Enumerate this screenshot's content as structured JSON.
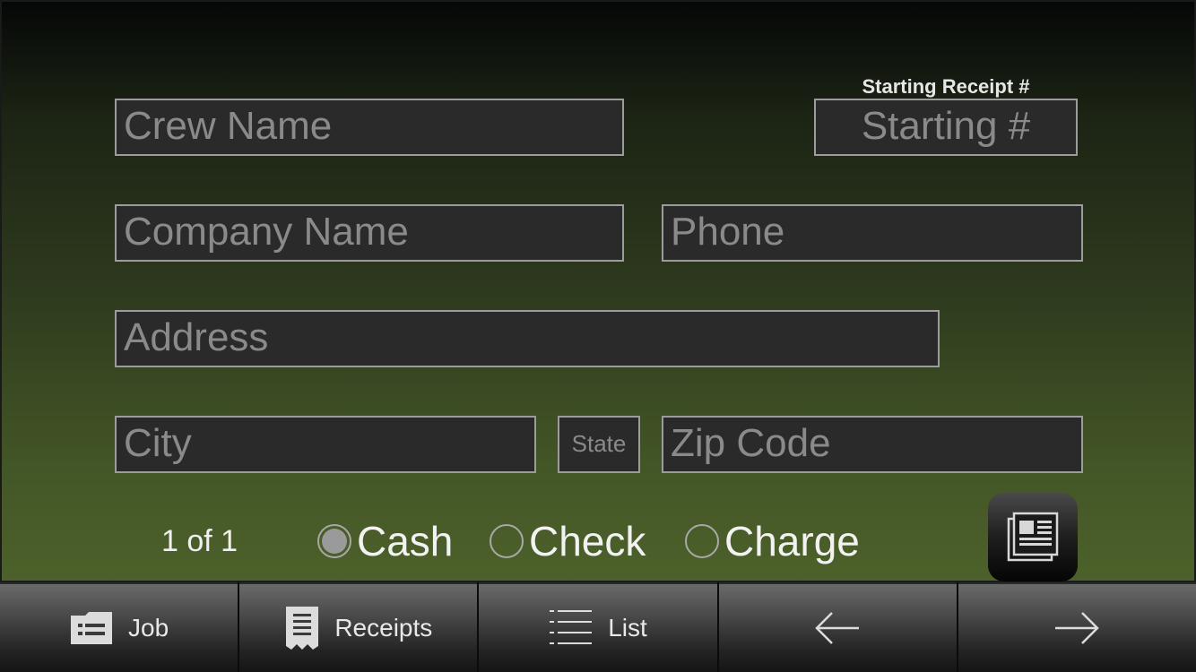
{
  "form": {
    "crew_name": {
      "placeholder": "Crew Name"
    },
    "starting_receipt": {
      "caption": "Starting Receipt #",
      "placeholder": "Starting #"
    },
    "company_name": {
      "placeholder": "Company Name"
    },
    "phone": {
      "placeholder": "Phone"
    },
    "address": {
      "placeholder": "Address"
    },
    "city": {
      "placeholder": "City"
    },
    "state": {
      "placeholder": "State"
    },
    "zip": {
      "placeholder": "Zip Code"
    }
  },
  "pager": {
    "text": "1 of 1"
  },
  "payment": {
    "options": [
      {
        "label": "Cash",
        "selected": true
      },
      {
        "label": "Check",
        "selected": false
      },
      {
        "label": "Charge",
        "selected": false
      }
    ]
  },
  "doc_button": {
    "icon": "document-icon"
  },
  "tabbar": {
    "tabs": [
      {
        "label": "Job",
        "icon": "folder-list-icon"
      },
      {
        "label": "Receipts",
        "icon": "receipt-icon"
      },
      {
        "label": "List",
        "icon": "list-icon"
      },
      {
        "label": "",
        "icon": "arrow-left-icon"
      },
      {
        "label": "",
        "icon": "arrow-right-icon"
      }
    ]
  },
  "colors": {
    "background_top": "#050707",
    "background_bottom": "#4d612b",
    "field_background": "#2a2a2a",
    "field_border": "#9c9c9c",
    "placeholder_text": "#8a8a8a"
  }
}
